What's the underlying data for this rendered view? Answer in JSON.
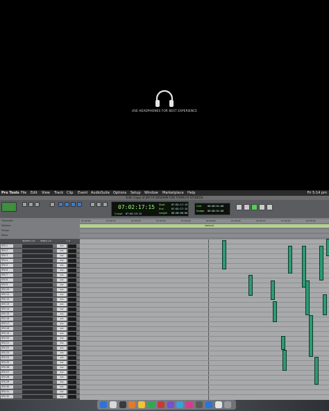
{
  "overlay": {
    "headphones_icon": "headphones-icon",
    "hint_text": "USE HEADPHONES FOR BEST EXPERIENCE"
  },
  "menubar": {
    "items": [
      "Pro Tools",
      "File",
      "Edit",
      "View",
      "Track",
      "Clip",
      "Event",
      "AudioSuite",
      "Options",
      "Setup",
      "Window",
      "Marketplace",
      "Help"
    ],
    "clock": "Fri 5:14 pm"
  },
  "window": {
    "title": "Edit: Copy of JAY FX SESSION FOR TOMA FX STUDIOS"
  },
  "counter": {
    "main": "07:02:17:15",
    "start_label": "Start",
    "end_label": "End",
    "length_label": "Length",
    "start": "07:02:17:15",
    "end": "07:02:17:15",
    "length": "00:00:00:00",
    "cursor_label": "Cursor",
    "cursor": "07:02:23:12"
  },
  "grid": {
    "grid_label": "Grid",
    "grid_value": "00:00:01:00",
    "nudge_label": "Nudge",
    "nudge_value": "00:00:01:00"
  },
  "rulers": {
    "labels": [
      "Timecode",
      "Markers",
      "Tempo",
      "Meter"
    ],
    "ticks": [
      "07:02:00",
      "07:02:10",
      "07:02:20",
      "07:02:30",
      "07:02:40",
      "07:02:50",
      "07:03:00",
      "07:03:10",
      "07:03:20",
      "07:03:30"
    ],
    "marker_text": "PREQUEL"
  },
  "tracks": {
    "column_headers": [
      "",
      "INSERTS A-E",
      "SENDS A-E",
      "I / O"
    ],
    "names": [
      "SFX 1",
      "SFX 2",
      "SFX 3",
      "SFX 4",
      "SFX 5",
      "SFX 6",
      "SFX 7",
      "SFX 8",
      "SFX 9",
      "SFX 10",
      "SFX 11",
      "SFX 12",
      "SFX 13",
      "SFX 14",
      "SFX 15",
      "SFX 16",
      "SFX 17",
      "SFX 18",
      "SFX 19",
      "SFX 20",
      "SFX 21",
      "SFX 22",
      "SFX 23",
      "SFX 24",
      "SFX 25",
      "SFX 26",
      "SFX 27",
      "SFX 28",
      "SFX 29",
      "SFX 30",
      "SFX 31",
      "SFX 32"
    ],
    "volume": "0.0"
  },
  "colors": {
    "clip": "#2f9a73",
    "counter_text": "#9bff7a",
    "play": "#4cd44c"
  }
}
